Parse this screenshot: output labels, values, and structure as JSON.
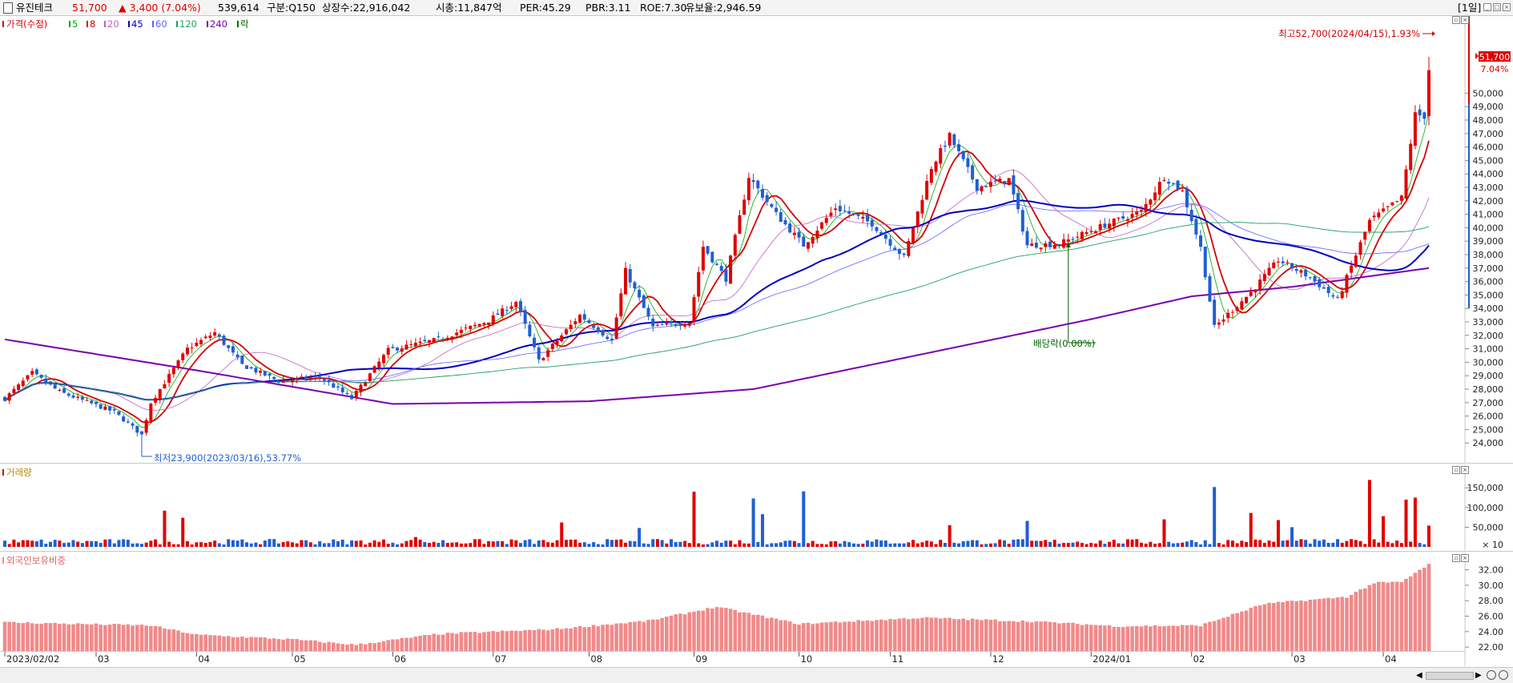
{
  "header": {
    "icon": "doc-icon",
    "name": "유진테크",
    "price": "51,700",
    "change": "▲ 3,400 (7.04%)",
    "volume": "539,614",
    "market": "구분:Q150",
    "shares": "상장수:22,916,042",
    "cap": "시총:11,847억",
    "per": "PER:45.29",
    "pbr": "PBR:3.11",
    "roe": "ROE:7.30",
    "float": "유보율:2,946.59",
    "period": "[1일]"
  },
  "price_legend": {
    "label": "가격(수정)",
    "items": [
      {
        "label": "5",
        "color": "#00aa00"
      },
      {
        "label": "8",
        "color": "#d40000"
      },
      {
        "label": "20",
        "color": "#c060c0"
      },
      {
        "label": "45",
        "color": "#0000c0"
      },
      {
        "label": "60",
        "color": "#6060ff"
      },
      {
        "label": "120",
        "color": "#20a060"
      },
      {
        "label": "240",
        "color": "#7a00b0"
      },
      {
        "label": "락",
        "color": "#006000"
      }
    ]
  },
  "annotations": {
    "high": "최고52,700(2024/04/15),1.93%",
    "low": "최저23,900(2023/03/16),53.77%",
    "dividend": "배당락(0.00%)",
    "last_price": "51,700",
    "last_pct": "7.04%"
  },
  "volume_legend": "거래량",
  "foreign_legend": "외국인보유비중",
  "volume_unit": "× 10",
  "colors": {
    "up": "#e00000",
    "down": "#1f5fd1",
    "foreign": "#f08a8a"
  },
  "chart_data": [
    {
      "type": "candlestick",
      "title": "",
      "yticks": [
        24000,
        25000,
        26000,
        27000,
        28000,
        29000,
        30000,
        31000,
        32000,
        33000,
        34000,
        35000,
        36000,
        37000,
        38000,
        39000,
        40000,
        41000,
        42000,
        43000,
        44000,
        45000,
        46000,
        47000,
        48000,
        49000,
        50000
      ],
      "ylim": [
        23300,
        54900
      ],
      "x_labels": [
        "2023/02/02",
        "03",
        "04",
        "05",
        "06",
        "07",
        "08",
        "09",
        "10",
        "11",
        "12",
        "2024/01",
        "02",
        "03",
        "04"
      ],
      "x_label_dates": [
        "2023-02-02",
        "2023-03-02",
        "2023-04-03",
        "2023-05-02",
        "2023-06-01",
        "2023-07-03",
        "2023-08-01",
        "2023-09-01",
        "2023-10-04",
        "2023-11-01",
        "2023-12-01",
        "2024-01-02",
        "2024-02-01",
        "2024-03-04",
        "2024-04-01"
      ],
      "last_date": "2024-04-15",
      "anchors": [
        {
          "date": "2023-02-02",
          "close": 27300
        },
        {
          "date": "2023-02-10",
          "close": 29200
        },
        {
          "date": "2023-02-20",
          "close": 27800
        },
        {
          "date": "2023-03-08",
          "close": 26300
        },
        {
          "date": "2023-03-16",
          "close": 24600
        },
        {
          "date": "2023-03-20",
          "close": 27000
        },
        {
          "date": "2023-03-30",
          "close": 31000
        },
        {
          "date": "2023-04-07",
          "close": 32200
        },
        {
          "date": "2023-04-17",
          "close": 29800
        },
        {
          "date": "2023-04-27",
          "close": 28600
        },
        {
          "date": "2023-05-10",
          "close": 28900
        },
        {
          "date": "2023-05-19",
          "close": 27300
        },
        {
          "date": "2023-05-31",
          "close": 30900
        },
        {
          "date": "2023-06-15",
          "close": 31700
        },
        {
          "date": "2023-06-30",
          "close": 33100
        },
        {
          "date": "2023-07-10",
          "close": 34500
        },
        {
          "date": "2023-07-17",
          "close": 30100
        },
        {
          "date": "2023-07-28",
          "close": 33500
        },
        {
          "date": "2023-08-08",
          "close": 31600
        },
        {
          "date": "2023-08-11",
          "close": 36800
        },
        {
          "date": "2023-08-21",
          "close": 32600
        },
        {
          "date": "2023-08-31",
          "close": 33000
        },
        {
          "date": "2023-09-05",
          "close": 38600
        },
        {
          "date": "2023-09-12",
          "close": 36200
        },
        {
          "date": "2023-09-19",
          "close": 43800
        },
        {
          "date": "2023-09-27",
          "close": 41000
        },
        {
          "date": "2023-10-05",
          "close": 38700
        },
        {
          "date": "2023-10-16",
          "close": 41500
        },
        {
          "date": "2023-10-26",
          "close": 40300
        },
        {
          "date": "2023-11-06",
          "close": 37800
        },
        {
          "date": "2023-11-14",
          "close": 44500
        },
        {
          "date": "2023-11-20",
          "close": 46800
        },
        {
          "date": "2023-11-28",
          "close": 43000
        },
        {
          "date": "2023-12-07",
          "close": 43600
        },
        {
          "date": "2023-12-13",
          "close": 38700
        },
        {
          "date": "2023-12-22",
          "close": 38800
        },
        {
          "date": "2024-01-05",
          "close": 40200
        },
        {
          "date": "2024-01-17",
          "close": 41200
        },
        {
          "date": "2024-01-24",
          "close": 43800
        },
        {
          "date": "2024-01-30",
          "close": 42700
        },
        {
          "date": "2024-02-05",
          "close": 38500
        },
        {
          "date": "2024-02-08",
          "close": 32600
        },
        {
          "date": "2024-02-20",
          "close": 35200
        },
        {
          "date": "2024-02-28",
          "close": 37600
        },
        {
          "date": "2024-03-08",
          "close": 36300
        },
        {
          "date": "2024-03-18",
          "close": 34600
        },
        {
          "date": "2024-03-27",
          "close": 40500
        },
        {
          "date": "2024-04-05",
          "close": 42200
        },
        {
          "date": "2024-04-10",
          "close": 48400
        },
        {
          "date": "2024-04-12",
          "close": 48300
        },
        {
          "date": "2024-04-15",
          "close": 51700
        }
      ],
      "ma_periods": [
        5,
        8,
        20,
        45,
        60,
        120,
        240
      ],
      "ma240_points": [
        {
          "date": "2023-02-02",
          "value": 31700
        },
        {
          "date": "2023-04-03",
          "value": 29400
        },
        {
          "date": "2023-06-01",
          "value": 26900
        },
        {
          "date": "2023-08-01",
          "value": 27100
        },
        {
          "date": "2023-09-20",
          "value": 28000
        },
        {
          "date": "2024-01-02",
          "value": 33200
        },
        {
          "date": "2024-02-01",
          "value": 34900
        },
        {
          "date": "2024-03-04",
          "value": 35600
        },
        {
          "date": "2024-04-15",
          "value": 37000
        }
      ],
      "markers": [
        {
          "date": "2023-12-26",
          "label": "배당락(0.00%)"
        }
      ],
      "high": {
        "date": "2024-04-15",
        "value": 52700
      },
      "low": {
        "date": "2023-03-16",
        "value": 23900
      },
      "last": 51700
    },
    {
      "type": "bar",
      "title": "거래량",
      "yticks": [
        50000,
        100000,
        150000
      ],
      "ylim": [
        0,
        185000
      ],
      "spikes": [
        {
          "date": "2023-03-23",
          "value": 92000
        },
        {
          "date": "2023-03-29",
          "value": 74000
        },
        {
          "date": "2023-06-08",
          "value": 25000
        },
        {
          "date": "2023-07-24",
          "value": 62000
        },
        {
          "date": "2023-08-16",
          "value": 48000
        },
        {
          "date": "2023-09-01",
          "value": 140000
        },
        {
          "date": "2023-09-20",
          "value": 123000
        },
        {
          "date": "2023-09-22",
          "value": 83000
        },
        {
          "date": "2023-10-05",
          "value": 141000
        },
        {
          "date": "2023-11-20",
          "value": 55000
        },
        {
          "date": "2023-12-13",
          "value": 66000
        },
        {
          "date": "2024-01-24",
          "value": 70000
        },
        {
          "date": "2024-02-08",
          "value": 152000
        },
        {
          "date": "2024-02-20",
          "value": 86000
        },
        {
          "date": "2024-02-28",
          "value": 68000
        },
        {
          "date": "2024-03-04",
          "value": 50000
        },
        {
          "date": "2024-03-27",
          "value": 170000
        },
        {
          "date": "2024-04-01",
          "value": 78000
        },
        {
          "date": "2024-04-08",
          "value": 120000
        },
        {
          "date": "2024-04-10",
          "value": 125000
        },
        {
          "date": "2024-04-15",
          "value": 54000
        }
      ]
    },
    {
      "type": "bar",
      "title": "외국인보유비중",
      "yticks": [
        22.0,
        24.0,
        26.0,
        28.0,
        30.0,
        32.0
      ],
      "ylim": [
        21.5,
        33.2
      ],
      "anchors": [
        {
          "date": "2023-02-02",
          "value": 25.2
        },
        {
          "date": "2023-03-20",
          "value": 24.8
        },
        {
          "date": "2023-04-03",
          "value": 23.6
        },
        {
          "date": "2023-05-02",
          "value": 23.0
        },
        {
          "date": "2023-05-22",
          "value": 22.3
        },
        {
          "date": "2023-06-15",
          "value": 23.7
        },
        {
          "date": "2023-07-20",
          "value": 24.3
        },
        {
          "date": "2023-08-20",
          "value": 25.4
        },
        {
          "date": "2023-09-10",
          "value": 27.2
        },
        {
          "date": "2023-10-04",
          "value": 25.0
        },
        {
          "date": "2023-11-10",
          "value": 25.8
        },
        {
          "date": "2023-12-15",
          "value": 25.3
        },
        {
          "date": "2024-01-10",
          "value": 24.7
        },
        {
          "date": "2024-02-05",
          "value": 24.8
        },
        {
          "date": "2024-02-25",
          "value": 27.6
        },
        {
          "date": "2024-03-20",
          "value": 28.5
        },
        {
          "date": "2024-03-28",
          "value": 30.3
        },
        {
          "date": "2024-04-05",
          "value": 30.4
        },
        {
          "date": "2024-04-15",
          "value": 32.7
        }
      ]
    }
  ]
}
